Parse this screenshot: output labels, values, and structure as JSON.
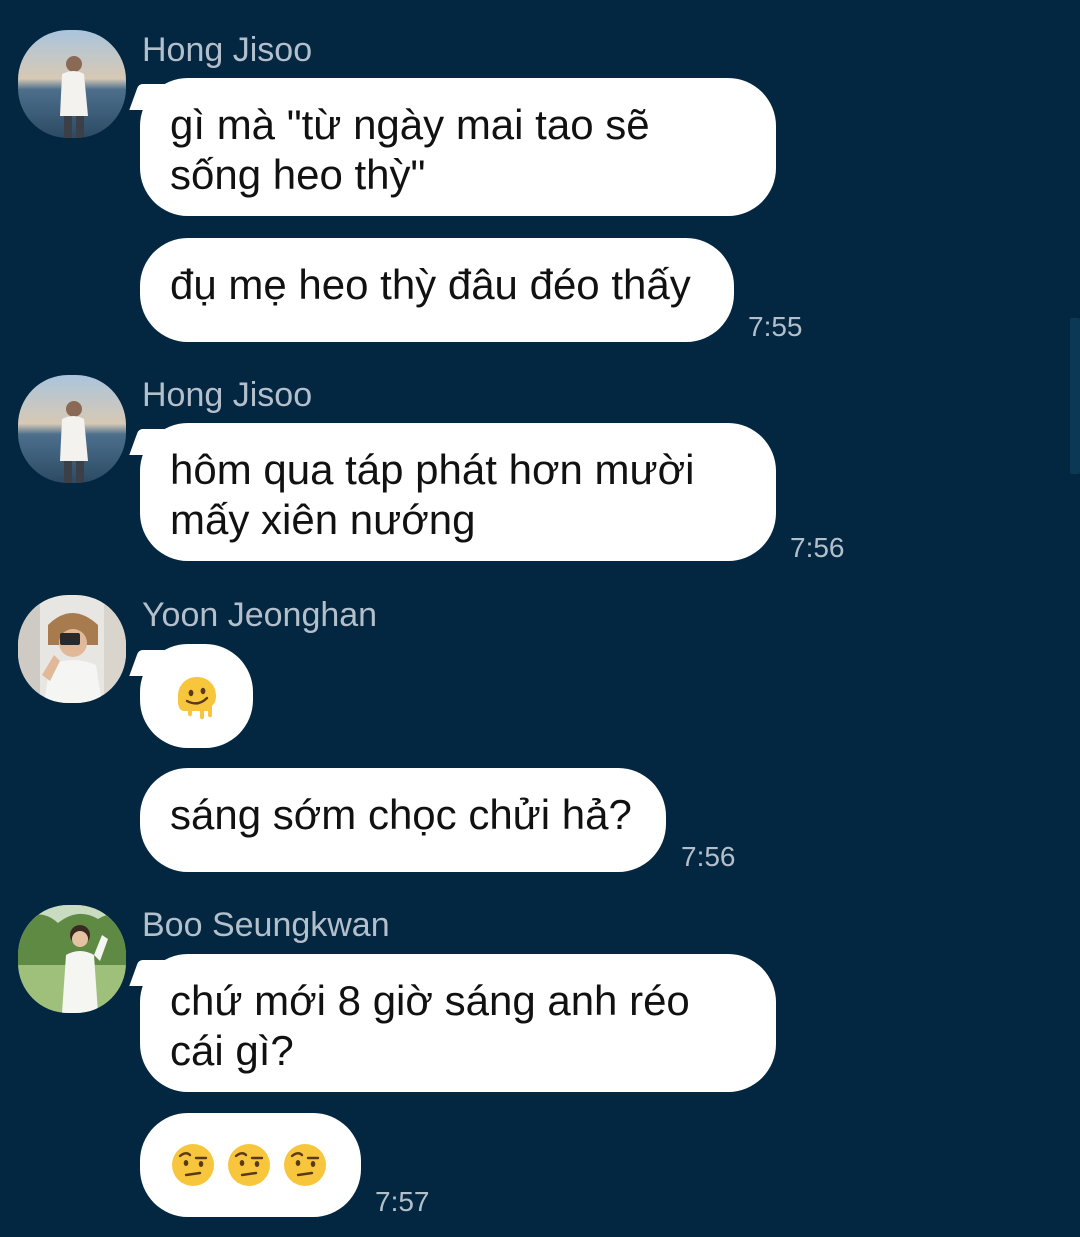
{
  "chat": {
    "groups": [
      {
        "sender": "Hong Jisoo",
        "avatar": "avatar-hong-jisoo",
        "messages": [
          "gì mà \"từ ngày mai tao sẽ sống heo thỳ\"",
          "đụ mẹ heo thỳ đâu đéo thấy"
        ],
        "time": "7:55"
      },
      {
        "sender": "Hong Jisoo",
        "avatar": "avatar-hong-jisoo",
        "messages": [
          "hôm qua táp phát hơn mười mấy xiên nướng"
        ],
        "time": "7:56"
      },
      {
        "sender": "Yoon Jeonghan",
        "avatar": "avatar-yoon-jeonghan",
        "messages": [
          "melting-face-emoji",
          "sáng sớm chọc chửi hả?"
        ],
        "time": "7:56"
      },
      {
        "sender": "Boo Seungkwan",
        "avatar": "avatar-boo-seungkwan",
        "messages": [
          "chứ mới 8 giờ sáng anh réo cái gì?",
          "face-with-raised-eyebrow-emoji x3"
        ],
        "time": "7:57"
      }
    ]
  },
  "colors": {
    "background": "#032741",
    "bubble": "#ffffff",
    "meta_text": "#b3bfca"
  }
}
